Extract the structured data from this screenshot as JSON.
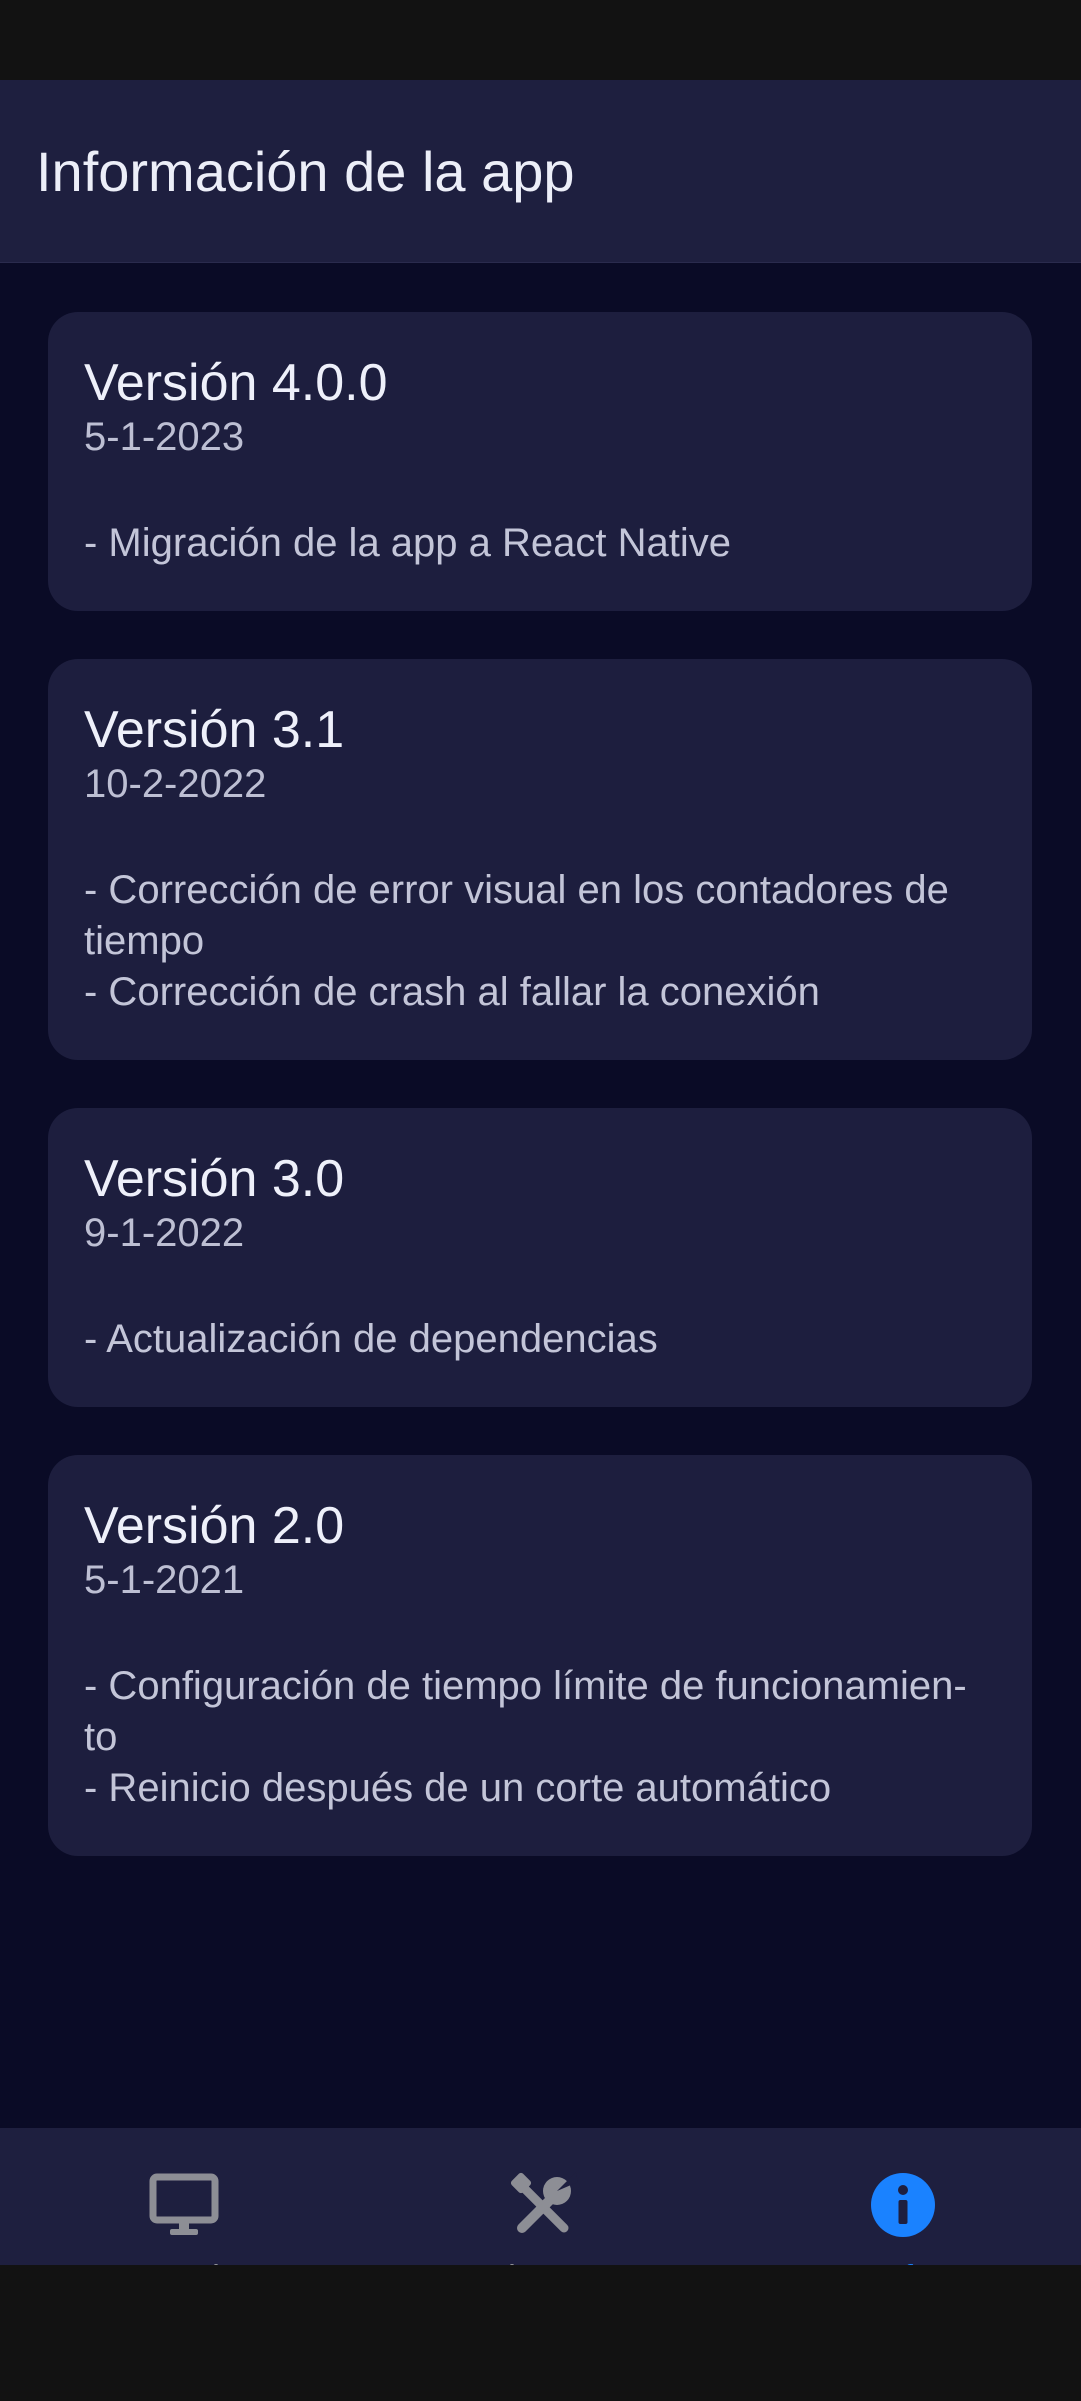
{
  "header": {
    "title": "Información de la app"
  },
  "versions": [
    {
      "title": "Versión 4.0.0",
      "date": "5-1-2023",
      "changes": [
        "- Migración de la app a React Native"
      ]
    },
    {
      "title": "Versión 3.1",
      "date": "10-2-2022",
      "changes": [
        "- Corrección de error visual en los contadores de",
        "tiempo",
        "- Corrección de crash al fallar la conexión"
      ]
    },
    {
      "title": "Versión 3.0",
      "date": "9-1-2022",
      "changes": [
        "- Actualización de dependencias"
      ]
    },
    {
      "title": "Versión 2.0",
      "date": "5-1-2021",
      "changes": [
        "- Configuración de tiempo límite de funcionamien-",
        "to",
        "- Reinicio después de un corte automático"
      ]
    }
  ],
  "nav": {
    "items": [
      {
        "label": "Estado",
        "icon": "monitor-icon",
        "active": false
      },
      {
        "label": "Ajustes",
        "icon": "tools-icon",
        "active": false
      },
      {
        "label": "Info",
        "icon": "info-icon",
        "active": true
      }
    ],
    "active_color": "#1a82ff",
    "inactive_color": "#8d8e95"
  },
  "colors": {
    "background": "#0a0b26",
    "surface": "#1e1f3f",
    "card": "#1d1e3e"
  }
}
